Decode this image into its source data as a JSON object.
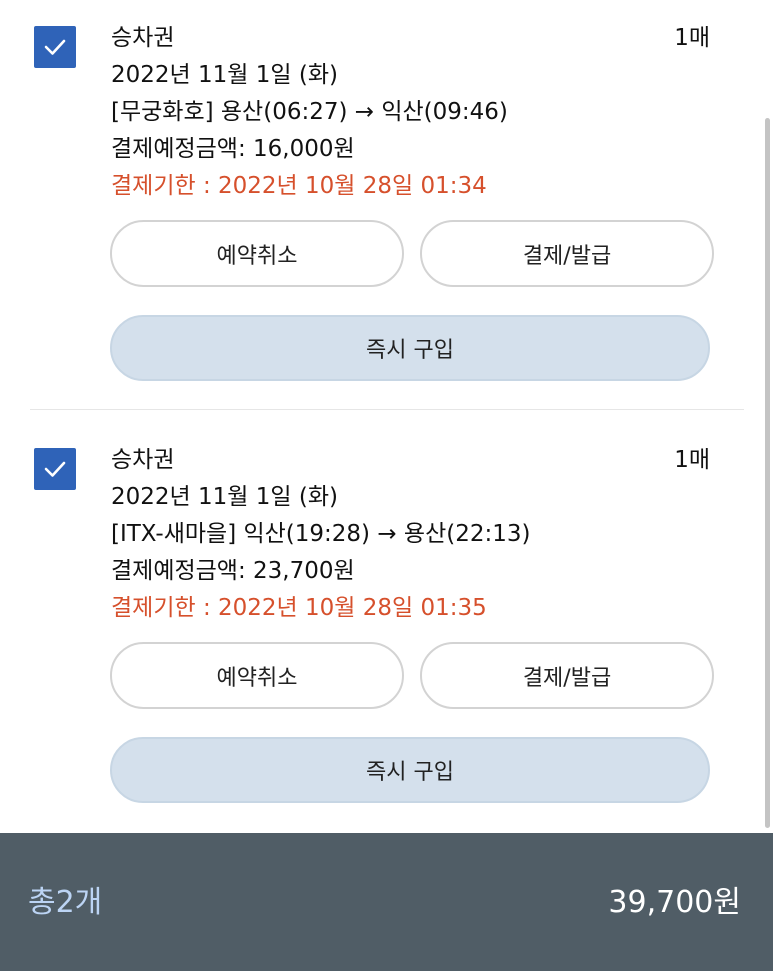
{
  "tickets": [
    {
      "checked": true,
      "title": "승차권",
      "quantity": "1매",
      "date": "2022년 11월 1일 (화)",
      "route": "[무궁화호] 용산(06:27) → 익산(09:46)",
      "amount": "결제예정금액: 16,000원",
      "deadline": "결제기한 : 2022년 10월 28일 01:34",
      "cancel_label": "예약취소",
      "pay_label": "결제/발급",
      "buy_label": "즉시 구입"
    },
    {
      "checked": true,
      "title": "승차권",
      "quantity": "1매",
      "date": "2022년 11월 1일 (화)",
      "route": "[ITX-새마을] 익산(19:28) → 용산(22:13)",
      "amount": "결제예정금액: 23,700원",
      "deadline": "결제기한 : 2022년 10월 28일 01:35",
      "cancel_label": "예약취소",
      "pay_label": "결제/발급",
      "buy_label": "즉시 구입"
    }
  ],
  "footer": {
    "count_label": "총2개",
    "total_amount": "39,700원"
  },
  "colors": {
    "checkbox": "#2f63b8",
    "deadline_text": "#d6502c",
    "buy_button_bg": "#d4e0ec",
    "footer_bg": "#505d66",
    "footer_count_text": "#bcd4f4"
  },
  "icons": {
    "checkbox": "check-icon"
  }
}
